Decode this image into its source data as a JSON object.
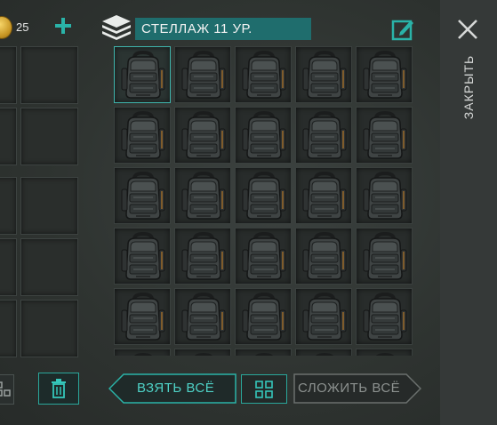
{
  "currency": {
    "coins": "25",
    "coin_icon": "coin-icon",
    "add_icon": "plus-icon"
  },
  "storage": {
    "title": "СТЕЛЛАЖ 11 УР.",
    "icon": "storage-shelf-icon",
    "edit_icon": "edit-note-icon",
    "items": [
      {
        "type": "backpack",
        "selected": true
      },
      {
        "type": "backpack"
      },
      {
        "type": "backpack"
      },
      {
        "type": "backpack"
      },
      {
        "type": "backpack"
      },
      {
        "type": "backpack"
      },
      {
        "type": "backpack"
      },
      {
        "type": "backpack"
      },
      {
        "type": "backpack"
      },
      {
        "type": "backpack"
      },
      {
        "type": "backpack"
      },
      {
        "type": "backpack"
      },
      {
        "type": "backpack"
      },
      {
        "type": "backpack"
      },
      {
        "type": "backpack"
      },
      {
        "type": "backpack"
      },
      {
        "type": "backpack"
      },
      {
        "type": "backpack"
      },
      {
        "type": "backpack"
      },
      {
        "type": "backpack"
      },
      {
        "type": "backpack"
      },
      {
        "type": "backpack"
      },
      {
        "type": "backpack"
      },
      {
        "type": "backpack"
      },
      {
        "type": "backpack"
      },
      {
        "type": "backpack"
      },
      {
        "type": "backpack"
      },
      {
        "type": "backpack"
      },
      {
        "type": "backpack"
      },
      {
        "type": "backpack"
      }
    ]
  },
  "actions": {
    "take_all": "ВЗЯТЬ ВСЁ",
    "stack_all": "СЛОЖИТЬ ВСЁ",
    "sort_icon": "sort-grid-icon",
    "trash_icon": "trash-icon"
  },
  "close": {
    "label": "ЗАКРЫТЬ",
    "icon": "close-icon"
  },
  "colors": {
    "accent": "#2ab3a8",
    "title_bar": "#1f6d6d",
    "panel": "#353938",
    "background": "#2f3431"
  }
}
